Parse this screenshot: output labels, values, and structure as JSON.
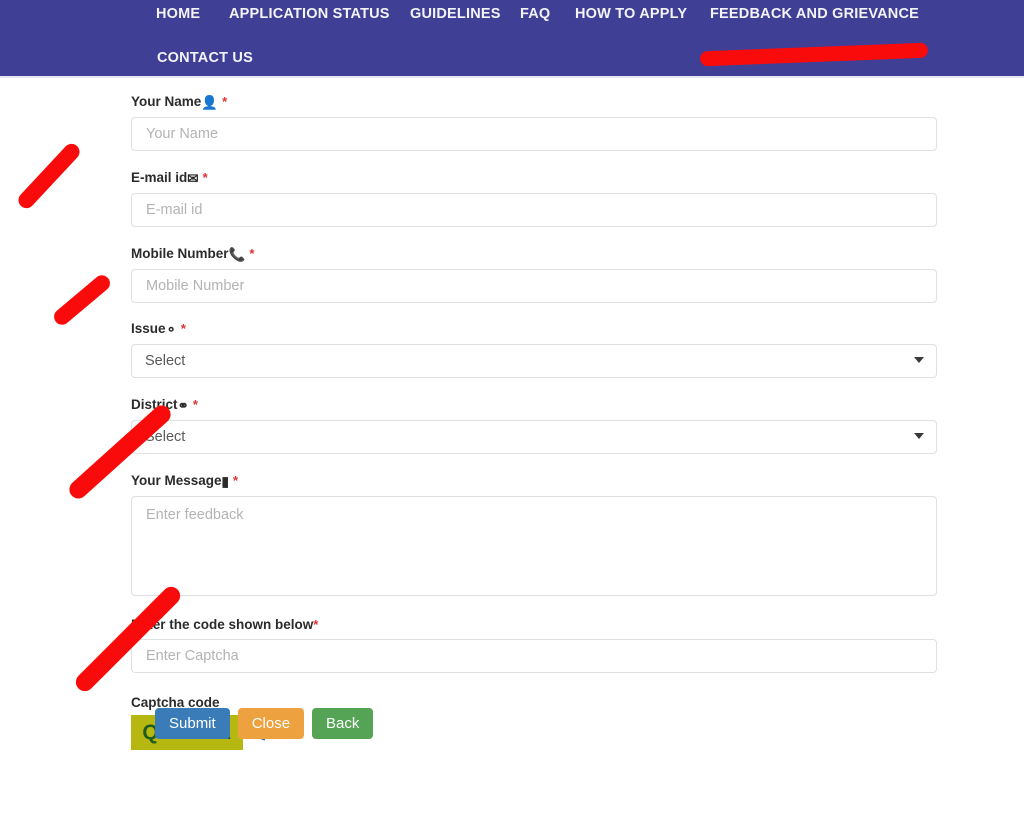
{
  "nav": {
    "items": [
      {
        "label": "HOME",
        "name": "nav-home"
      },
      {
        "label": "APPLICATION STATUS",
        "name": "nav-application-status"
      },
      {
        "label": "GUIDELINES",
        "name": "nav-guidelines"
      },
      {
        "label": "FAQ",
        "name": "nav-faq"
      },
      {
        "label": "HOW TO APPLY",
        "name": "nav-how-to-apply"
      },
      {
        "label": "FEEDBACK AND GRIEVANCE",
        "name": "nav-feedback-and-grievance"
      },
      {
        "label": "CONTACT US",
        "name": "nav-contact-us"
      }
    ],
    "background_color": "#3f3f96",
    "text_color": "#f3f3f8"
  },
  "form": {
    "name": {
      "label": "Your Name",
      "icon": "user-icon",
      "icon_glyph": "👤",
      "required_mark": "*",
      "placeholder": "Your Name",
      "value": ""
    },
    "email": {
      "label": "E-mail id",
      "icon": "envelope-icon",
      "icon_glyph": "✉",
      "required_mark": "*",
      "placeholder": "E-mail id",
      "value": ""
    },
    "mobile": {
      "label": "Mobile Number",
      "icon": "phone-icon",
      "icon_glyph": "📞",
      "required_mark": "*",
      "placeholder": "Mobile Number",
      "value": ""
    },
    "issue": {
      "label": "Issue",
      "icon": "question-circle-icon",
      "icon_glyph": "?",
      "required_mark": "*",
      "selected": "Select"
    },
    "district": {
      "label": "District",
      "icon": "globe-icon",
      "icon_glyph": "🌐",
      "required_mark": "*",
      "selected": "Select"
    },
    "message": {
      "label": "Your Message",
      "icon": "comment-icon",
      "icon_glyph": "💬",
      "required_mark": "*",
      "placeholder": "Enter feedback",
      "value": ""
    },
    "captcha_input": {
      "label": "Enter the code shown below",
      "required_mark": "*",
      "placeholder": "Enter Captcha",
      "value": ""
    },
    "captcha": {
      "label": "Captcha code",
      "code": "QMY80A",
      "background_color": "#b7b712",
      "text_color": "#1f5c1f",
      "refresh_icon": "refresh-icon"
    }
  },
  "buttons": {
    "submit": {
      "label": "Submit",
      "color": "#3a7cb8"
    },
    "close": {
      "label": "Close",
      "color": "#eda23f"
    },
    "back": {
      "label": "Back",
      "color": "#55a455"
    }
  },
  "annotations": {
    "color": "#fa0b0b",
    "marks": [
      {
        "name": "annotation-underline-feedback-menu",
        "type": "horizontal-stroke"
      },
      {
        "name": "annotation-arrow-name-field",
        "type": "diagonal-stroke"
      },
      {
        "name": "annotation-arrow-mobile-field",
        "type": "diagonal-stroke"
      },
      {
        "name": "annotation-arrow-district-field",
        "type": "diagonal-stroke"
      },
      {
        "name": "annotation-arrow-captcha-field",
        "type": "diagonal-stroke"
      }
    ]
  }
}
